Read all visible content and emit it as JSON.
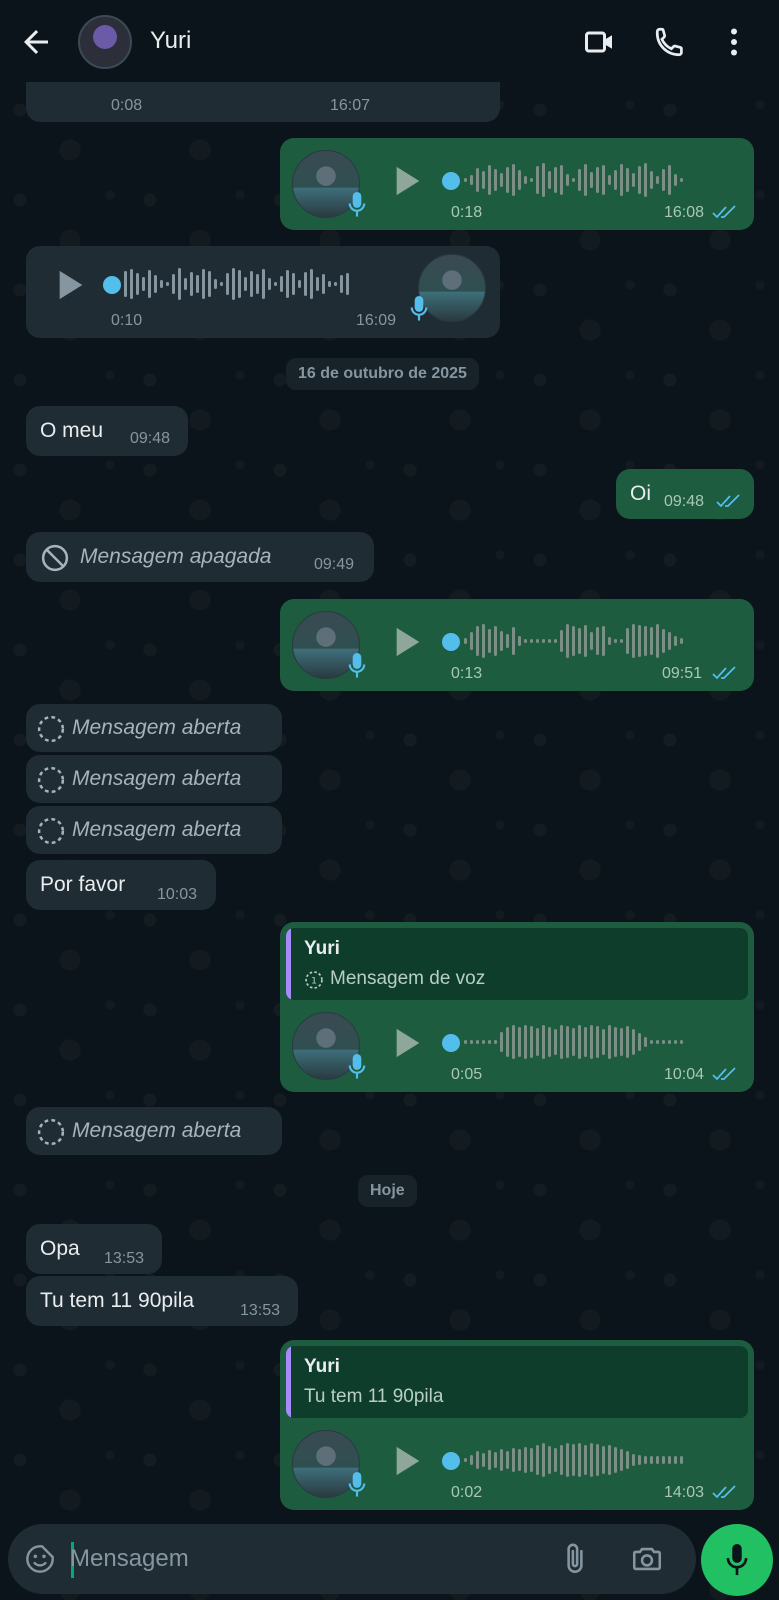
{
  "header": {
    "contact_name": "Yuri"
  },
  "icons": {
    "back": "arrow-left-icon",
    "video": "video-camera-icon",
    "call": "phone-icon",
    "menu": "more-vertical-icon",
    "emoji": "sticker-icon",
    "attach": "paperclip-icon",
    "camera": "camera-icon",
    "mic": "microphone-icon"
  },
  "colors": {
    "accent": "#21c063",
    "incoming_bubble": "#202c33",
    "outgoing_bubble": "#1d5c3f",
    "read_ticks": "#53bdeb"
  },
  "messages": {
    "m0": {
      "duration": "0:08",
      "time": "16:07"
    },
    "m1": {
      "duration": "0:18",
      "time": "16:08"
    },
    "m2": {
      "duration": "0:10",
      "time": "16:09"
    },
    "date1": "16 de outubro de 2025",
    "m3": {
      "text": "O meu",
      "time": "09:48"
    },
    "m4": {
      "text": "Oi",
      "time": "09:48"
    },
    "m5": {
      "text": "Mensagem apagada",
      "time": "09:49"
    },
    "m6": {
      "duration": "0:13",
      "time": "09:51"
    },
    "m7": {
      "text": "Mensagem aberta"
    },
    "m8": {
      "text": "Mensagem aberta"
    },
    "m9": {
      "text": "Mensagem aberta"
    },
    "m10": {
      "text": "Por favor",
      "time": "10:03"
    },
    "m11": {
      "quote_name": "Yuri",
      "quote_text": "Mensagem de voz",
      "duration": "0:05",
      "time": "10:04"
    },
    "m12": {
      "text": "Mensagem aberta"
    },
    "date2": "Hoje",
    "m13": {
      "text": "Opa",
      "time": "13:53"
    },
    "m14": {
      "text": "Tu tem 11 90pila",
      "time": "13:53"
    },
    "m15": {
      "quote_name": "Yuri",
      "quote_text": "Tu tem 11 90pila",
      "duration": "0:02",
      "time": "14:03"
    }
  },
  "composer": {
    "placeholder": "Mensagem"
  }
}
